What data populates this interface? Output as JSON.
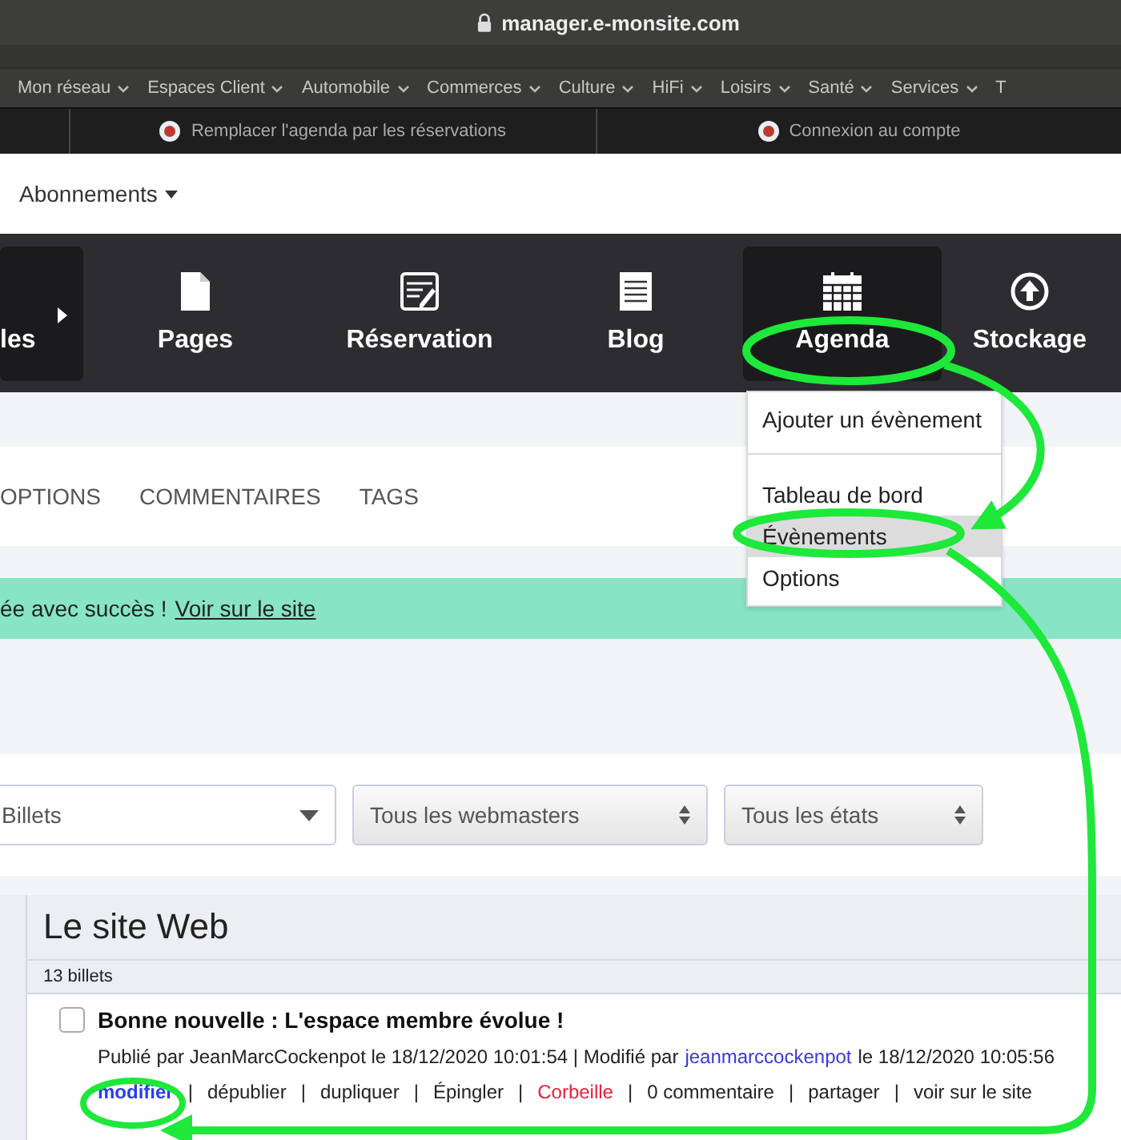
{
  "browser": {
    "url": "manager.e-monsite.com"
  },
  "bookmarks": [
    {
      "label": "Mon réseau",
      "menu": true
    },
    {
      "label": "Espaces Client",
      "menu": true
    },
    {
      "label": "Automobile",
      "menu": true
    },
    {
      "label": "Commerces",
      "menu": true
    },
    {
      "label": "Culture",
      "menu": true
    },
    {
      "label": "HiFi",
      "menu": true
    },
    {
      "label": "Loisirs",
      "menu": true
    },
    {
      "label": "Santé",
      "menu": true
    },
    {
      "label": "Services",
      "menu": true
    },
    {
      "label": "T",
      "menu": false
    }
  ],
  "shortcuts": [
    "Remplacer l'agenda par les réservations",
    "Connexion au compte"
  ],
  "account_menu": "Abonnements",
  "modules": [
    {
      "label": "les",
      "kind": "partial",
      "selected": true
    },
    {
      "label": "Pages",
      "kind": "page",
      "selected": false
    },
    {
      "label": "Réservation",
      "kind": "booking",
      "selected": false
    },
    {
      "label": "Blog",
      "kind": "notepad",
      "selected": false
    },
    {
      "label": "Agenda",
      "kind": "calendar",
      "selected": true
    },
    {
      "label": "Stockage",
      "kind": "upload",
      "selected": false
    }
  ],
  "dropdown": {
    "groups": [
      [
        {
          "label": "Ajouter un évènement",
          "selected": false
        }
      ],
      [
        {
          "label": "Tableau de bord",
          "selected": false
        },
        {
          "label": "Évènements",
          "selected": true
        },
        {
          "label": "Options",
          "selected": false
        }
      ]
    ]
  },
  "tabs": [
    "OPTIONS",
    "COMMENTAIRES",
    "TAGS"
  ],
  "banner": {
    "message": "ée avec succès !",
    "link": "Voir sur le site"
  },
  "filters": [
    {
      "value": "Billets",
      "kind": "dropdown"
    },
    {
      "value": "Tous les webmasters",
      "kind": "stepper"
    },
    {
      "value": "Tous les états",
      "kind": "stepper"
    }
  ],
  "list": {
    "title": "Le site Web",
    "count": "13 billets",
    "posts": [
      {
        "title": "Bonne nouvelle : L'espace membre évolue !",
        "checked": false,
        "meta_before": "Publié par JeanMarcCockenpot le 18/12/2020 10:01:54 | Modifié par",
        "author": "jeanmarccockenpot",
        "meta_after": "le 18/12/2020 10:05:56",
        "separator": "|",
        "actions": [
          {
            "label": "modifier",
            "kind": "primary"
          },
          {
            "label": "dépublier",
            "kind": "plain"
          },
          {
            "label": "dupliquer",
            "kind": "plain"
          },
          {
            "label": "Épingler",
            "kind": "plain"
          },
          {
            "label": "Corbeille",
            "kind": "danger"
          },
          {
            "label": "0 commentaire",
            "kind": "plain"
          },
          {
            "label": "partager",
            "kind": "plain"
          },
          {
            "label": "voir sur le site",
            "kind": "plain"
          }
        ]
      }
    ]
  }
}
